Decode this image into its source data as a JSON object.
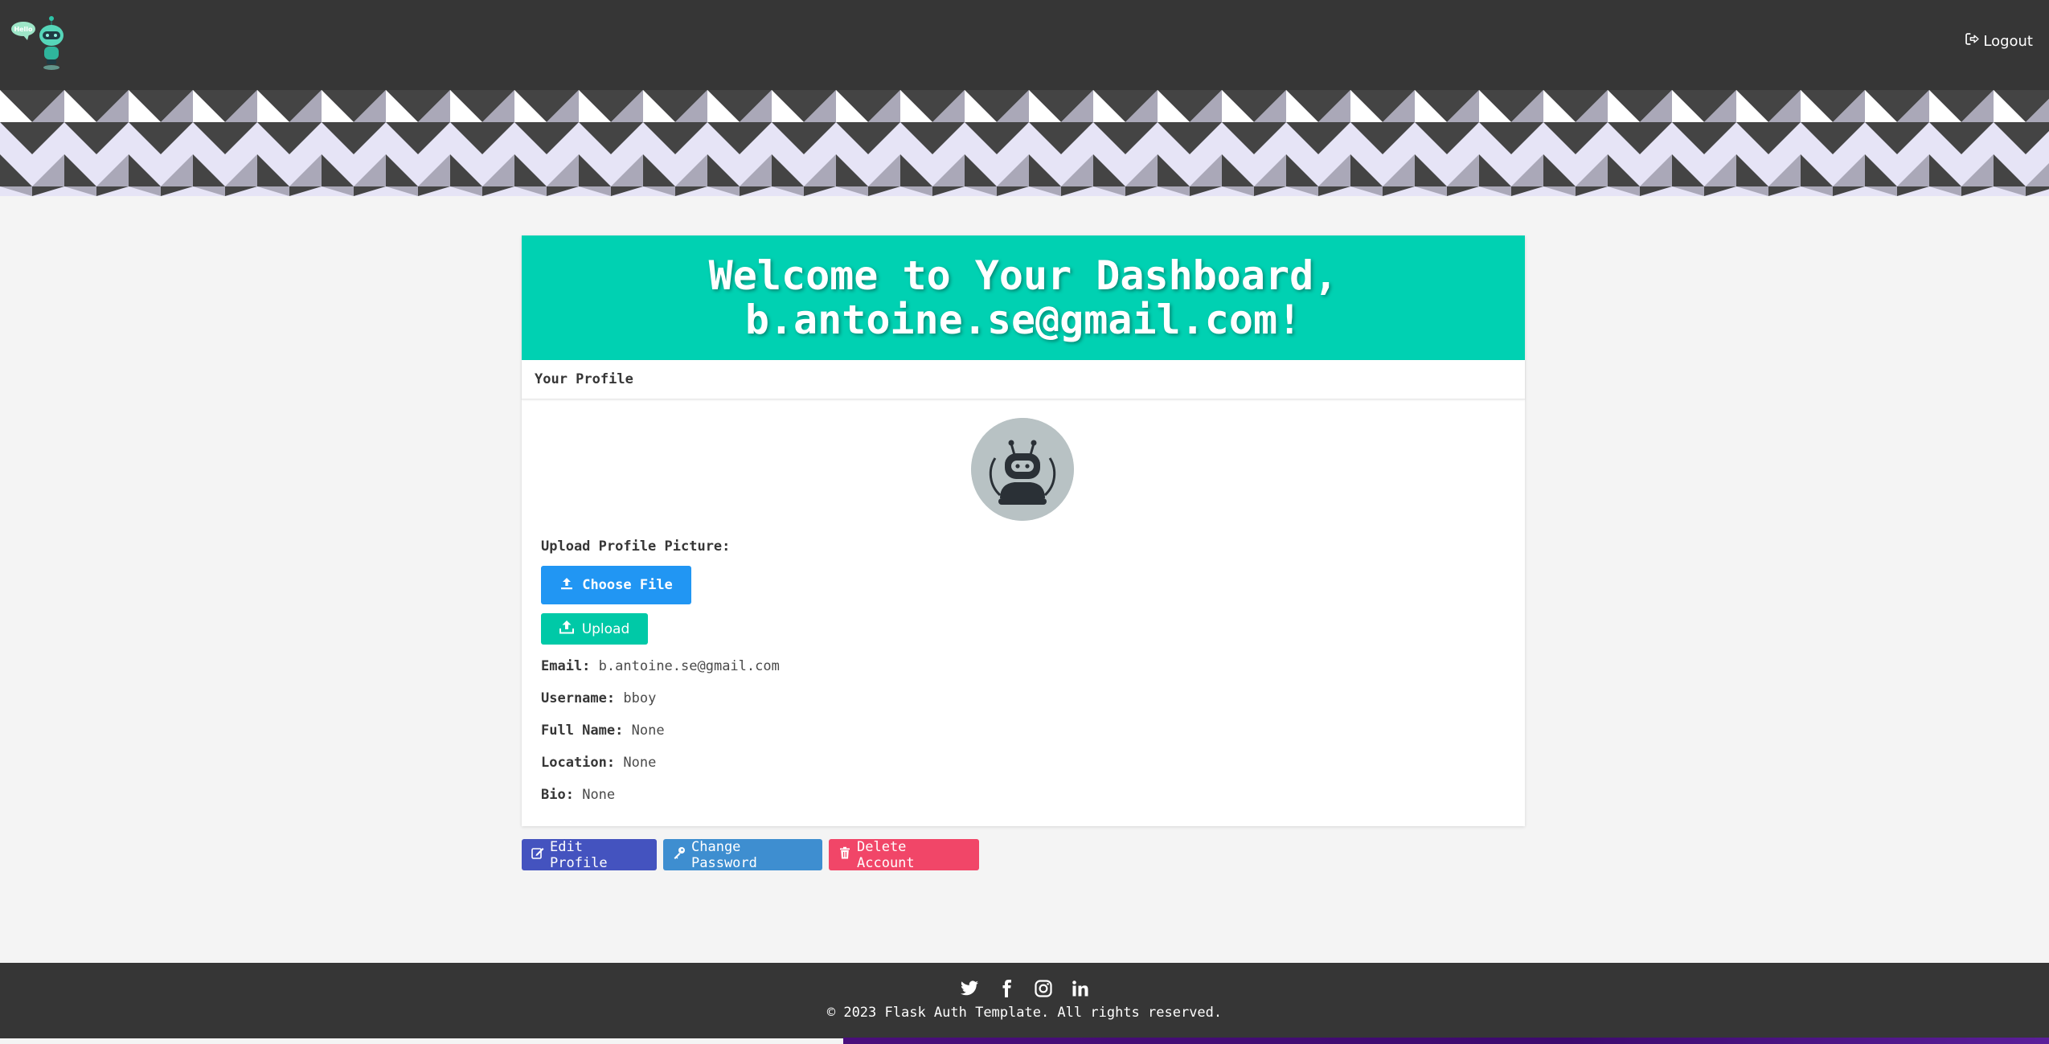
{
  "navbar": {
    "logo_text": "Hello",
    "logout_label": "Logout"
  },
  "hero": {
    "title": "Welcome to Your Dashboard, b.antoine.se@gmail.com!"
  },
  "profile": {
    "header": "Your Profile",
    "upload_label": "Upload Profile Picture:",
    "choose_file_label": "Choose File",
    "upload_button_label": "Upload",
    "fields": [
      {
        "label": "Email:",
        "value": "b.antoine.se@gmail.com"
      },
      {
        "label": "Username:",
        "value": "bboy"
      },
      {
        "label": "Full Name:",
        "value": "None"
      },
      {
        "label": "Location:",
        "value": "None"
      },
      {
        "label": "Bio:",
        "value": "None"
      }
    ]
  },
  "actions": {
    "edit_label": "Edit Profile",
    "password_label": "Change Password",
    "delete_label": "Delete Account"
  },
  "footer": {
    "social_icons": [
      "twitter-icon",
      "facebook-icon",
      "instagram-icon",
      "linkedin-icon"
    ],
    "copyright": "© 2023 Flask Auth Template. All rights reserved."
  },
  "colors": {
    "navbar": "#363636",
    "hero": "#00d1b2",
    "primary": "#2196f3",
    "upload": "#00c9a7",
    "edit": "#4453bf",
    "password": "#3e8ed0",
    "delete": "#f14668"
  }
}
